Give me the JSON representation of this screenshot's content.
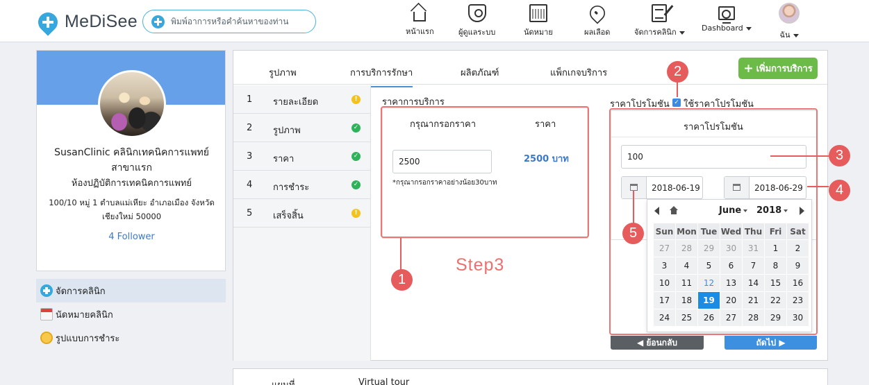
{
  "app": {
    "logo": "MeDiSee"
  },
  "search": {
    "placeholder": "พิมพ์อาการหรือคำค้นหาของท่าน"
  },
  "nav": {
    "home": "หน้าแรก",
    "admin": "ผู้ดูแลระบบ",
    "appointment": "นัดหมาย",
    "blood": "ผลเลือด",
    "clinic": "จัดการคลินิก",
    "dashboard": "Dashboard",
    "user": "ฉัน"
  },
  "profile": {
    "name_line1": "SusanClinic คลินิกเทคนิคการแพทย์",
    "name_line2": "สาขาแรก",
    "subtitle": "ห้องปฏิบัติการเทคนิคการแพทย์",
    "address": "100/10 หมู่ 1 ตำบลแม่เหียะ อำเภอเมือง จังหวัดเชียงใหม่ 50000",
    "followers": "4 Follower"
  },
  "sidemenu": [
    {
      "label": "จัดการคลินิก",
      "icon": "clinic-plus-icon"
    },
    {
      "label": "นัดหมายคลินิก",
      "icon": "calendar-icon"
    },
    {
      "label": "รูปแบบการชำระ",
      "icon": "coin-icon"
    }
  ],
  "tabs": {
    "photo": "รูปภาพ",
    "service": "การบริการรักษา",
    "product": "ผลิตภัณฑ์",
    "package": "แพ็กเกจบริการ"
  },
  "add_service_label": "เพิ่มการบริการ",
  "steps": [
    {
      "num": "1",
      "label": "รายละเอียด",
      "status": "!"
    },
    {
      "num": "2",
      "label": "รูปภาพ",
      "status": "✓"
    },
    {
      "num": "3",
      "label": "ราคา",
      "status": "✓"
    },
    {
      "num": "4",
      "label": "การชำระ",
      "status": "✓"
    },
    {
      "num": "5",
      "label": "เสร็จสิ้น",
      "status": "!"
    }
  ],
  "price": {
    "section_title": "ราคาการบริการ",
    "head_input": "กรุณากรอกราคา",
    "head_price": "ราคา",
    "value": "2500",
    "display": "2500 บาท",
    "hint": "*กรุณากรอกราคาอย่างน้อย30บาท"
  },
  "promo": {
    "section_title": "ราคาโปรโมชัน",
    "checkbox_label": "ใช้ราคาโปรโมชัน",
    "checkbox_mark": "✓",
    "box_title": "ราคาโปรโมชัน",
    "value": "100",
    "date_start": "2018-06-19",
    "date_end": "2018-06-29"
  },
  "datepicker": {
    "month": "June",
    "year": "2018",
    "weekdays": [
      "Sun",
      "Mon",
      "Tue",
      "Wed",
      "Thu",
      "Fri",
      "Sat"
    ],
    "weeks": [
      [
        "27",
        "28",
        "29",
        "30",
        "31",
        "1",
        "2"
      ],
      [
        "3",
        "4",
        "5",
        "6",
        "7",
        "8",
        "9"
      ],
      [
        "10",
        "11",
        "12",
        "13",
        "14",
        "15",
        "16"
      ],
      [
        "17",
        "18",
        "19",
        "20",
        "21",
        "22",
        "23"
      ],
      [
        "24",
        "25",
        "26",
        "27",
        "28",
        "29",
        "30"
      ]
    ],
    "today": "12",
    "selected": "19"
  },
  "buttons": {
    "back": "ย้อนกลับ",
    "next": "ถัดไป"
  },
  "annotations": {
    "b1": "1",
    "b2": "2",
    "b3": "3",
    "b4": "4",
    "b5": "5",
    "step": "Step3"
  },
  "bottom_tabs": {
    "map": "แผนที่",
    "tour": "Virtual tour"
  },
  "colors": {
    "accent": "#36a8dd",
    "annotation": "#e65b5b",
    "success": "#2fb35a",
    "warning": "#f3c21c",
    "selected_day": "#1c8be3"
  }
}
